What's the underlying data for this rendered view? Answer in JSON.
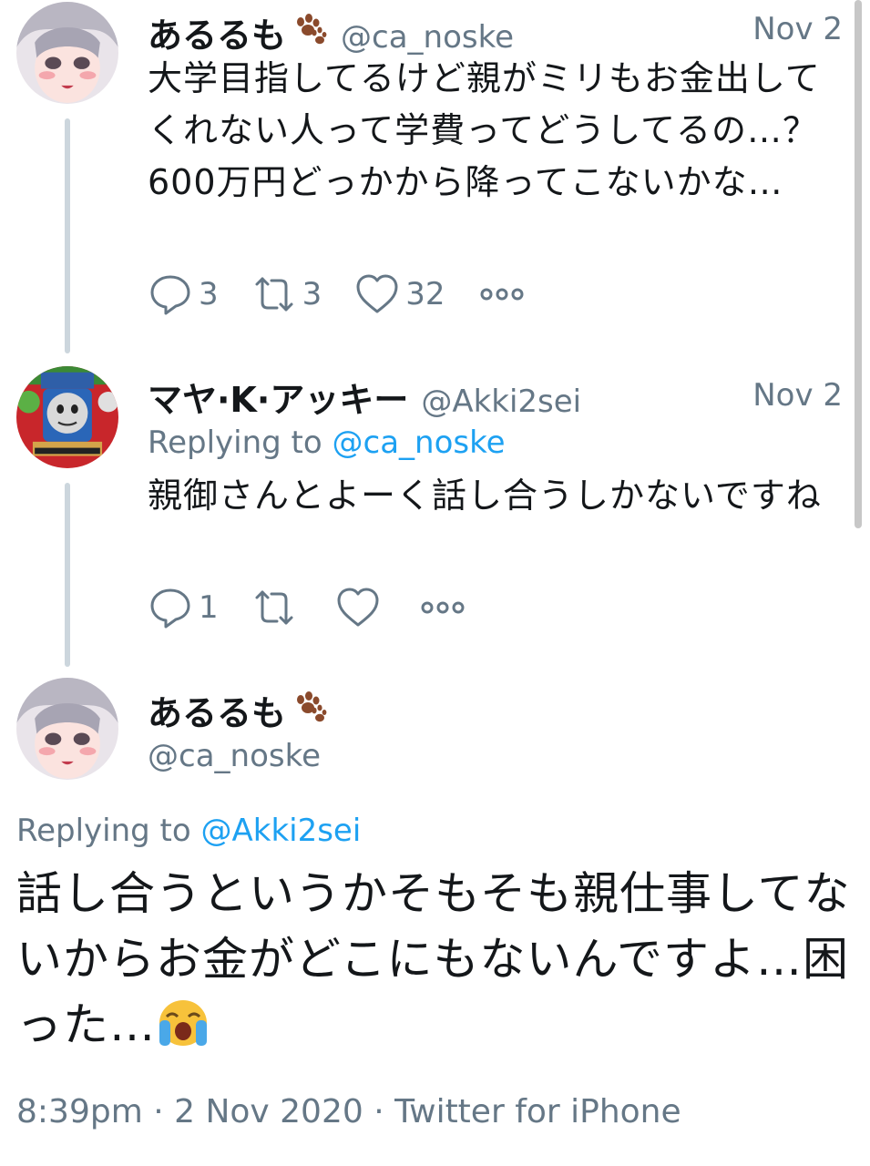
{
  "thread": [
    {
      "name": "あるるも",
      "handle": "@ca_noske",
      "date": "Nov 2",
      "text": "大学目指してるけど親がミリもお金出してくれない人って学費ってどうしてるの…？600万円どっかから降ってこないかな…",
      "reply_count": "3",
      "retweet_count": "3",
      "like_count": "32"
    },
    {
      "name": "マヤ·K·アッキー",
      "handle": "@Akki2sei",
      "date": "Nov 2",
      "replying_prefix": "Replying to",
      "replying_to": "@ca_noske",
      "text": "親御さんとよーく話し合うしかないですね",
      "reply_count": "1",
      "retweet_count": "",
      "like_count": ""
    }
  ],
  "main_tweet": {
    "name": "あるるも",
    "handle": "@ca_noske",
    "replying_prefix": "Replying to",
    "replying_to": "@Akki2sei",
    "text": "話し合うというかそもそも親仕事してないからお金がどこにもないんですよ…困った…",
    "emoji": "loudly-crying-face",
    "timestamp": "8:39pm · 2 Nov 2020 · Twitter for iPhone"
  },
  "colors": {
    "text": "#14171a",
    "secondary": "#657786",
    "link": "#1da1f2",
    "thread_line": "#ccd6dd"
  },
  "icons": [
    "paw-prints-icon",
    "reply-icon",
    "retweet-icon",
    "like-icon",
    "more-icon",
    "loudly-crying-face-emoji"
  ]
}
